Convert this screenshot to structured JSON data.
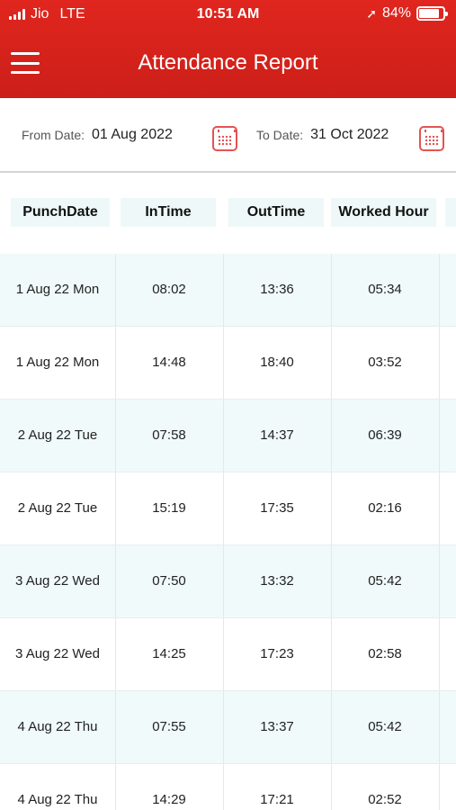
{
  "status_bar": {
    "carrier": "Jio",
    "network": "LTE",
    "time": "10:51 AM",
    "battery": "84%",
    "battery_level": 0.84
  },
  "header": {
    "title": "Attendance Report",
    "color": "#d6221c"
  },
  "filters": {
    "from_label": "From Date:",
    "from_value": "01 Aug 2022",
    "to_label": "To Date:",
    "to_value": "31 Oct 2022"
  },
  "table": {
    "columns": [
      "PunchDate",
      "InTime",
      "OutTime",
      "Worked Hour"
    ],
    "rows": [
      [
        "1 Aug 22 Mon",
        "08:02",
        "13:36",
        "05:34"
      ],
      [
        "1 Aug 22 Mon",
        "14:48",
        "18:40",
        "03:52"
      ],
      [
        "2 Aug 22 Tue",
        "07:58",
        "14:37",
        "06:39"
      ],
      [
        "2 Aug 22 Tue",
        "15:19",
        "17:35",
        "02:16"
      ],
      [
        "3 Aug 22 Wed",
        "07:50",
        "13:32",
        "05:42"
      ],
      [
        "3 Aug 22 Wed",
        "14:25",
        "17:23",
        "02:58"
      ],
      [
        "4 Aug 22 Thu",
        "07:55",
        "13:37",
        "05:42"
      ],
      [
        "4 Aug 22 Thu",
        "14:29",
        "17:21",
        "02:52"
      ]
    ]
  },
  "icons": {
    "menu": "hamburger-menu-icon",
    "calendar": "calendar-icon",
    "location": "location-arrow-icon",
    "signal": "signal-bars-icon",
    "battery": "battery-icon"
  }
}
